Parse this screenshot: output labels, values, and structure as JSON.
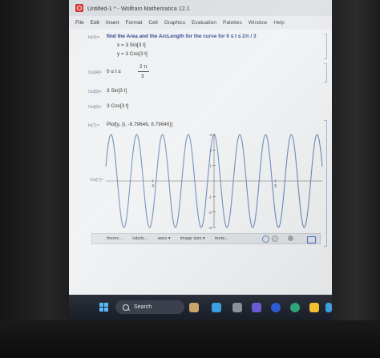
{
  "window": {
    "title": "Untitled-1 * - Wolfram Mathematica 12.1"
  },
  "menu": [
    "File",
    "Edit",
    "Insert",
    "Format",
    "Cell",
    "Graphics",
    "Evaluation",
    "Palettes",
    "Window",
    "Help"
  ],
  "notebook": {
    "in1_label": "In[4]:=",
    "in1_text": "find the Area and the ArcLength for the curve for 0 ≤ t ≤ 2π / 3",
    "in1_x": "x = 3 Sin[3 t]",
    "in1_y": "y = 3 Cos[3 t]",
    "out1_label": "Out[4]=",
    "out1_text": "0 ≤ t ≤",
    "out1_frac_num": "2 π",
    "out1_frac_den": "3",
    "out2_label": "Out[5]=",
    "out2_text": "3 Sin[3 t]",
    "out3_label": "Out[6]=",
    "out3_text": "3 Cos[3 t]",
    "in2_label": "In[7]:=",
    "in2_text": "Plot[y, {t, -8.79646, 8.79646}]",
    "out4_label": "Out[7]="
  },
  "plot_toolbar": [
    "theme...",
    "labels...",
    "axes ▾",
    "image size ▾",
    "more..."
  ],
  "taskbar": {
    "search_label": "Search"
  },
  "chart_data": {
    "type": "line",
    "function": "3 Cos[3 t]",
    "x_range": [
      -8.79646,
      8.79646
    ],
    "ylim": [
      -3,
      3
    ],
    "x_ticks": [
      "-5",
      "5"
    ],
    "y_ticks": [
      "3",
      "2",
      "1",
      "-1",
      "-2",
      "-3"
    ],
    "line_color": "#5e81b5"
  }
}
